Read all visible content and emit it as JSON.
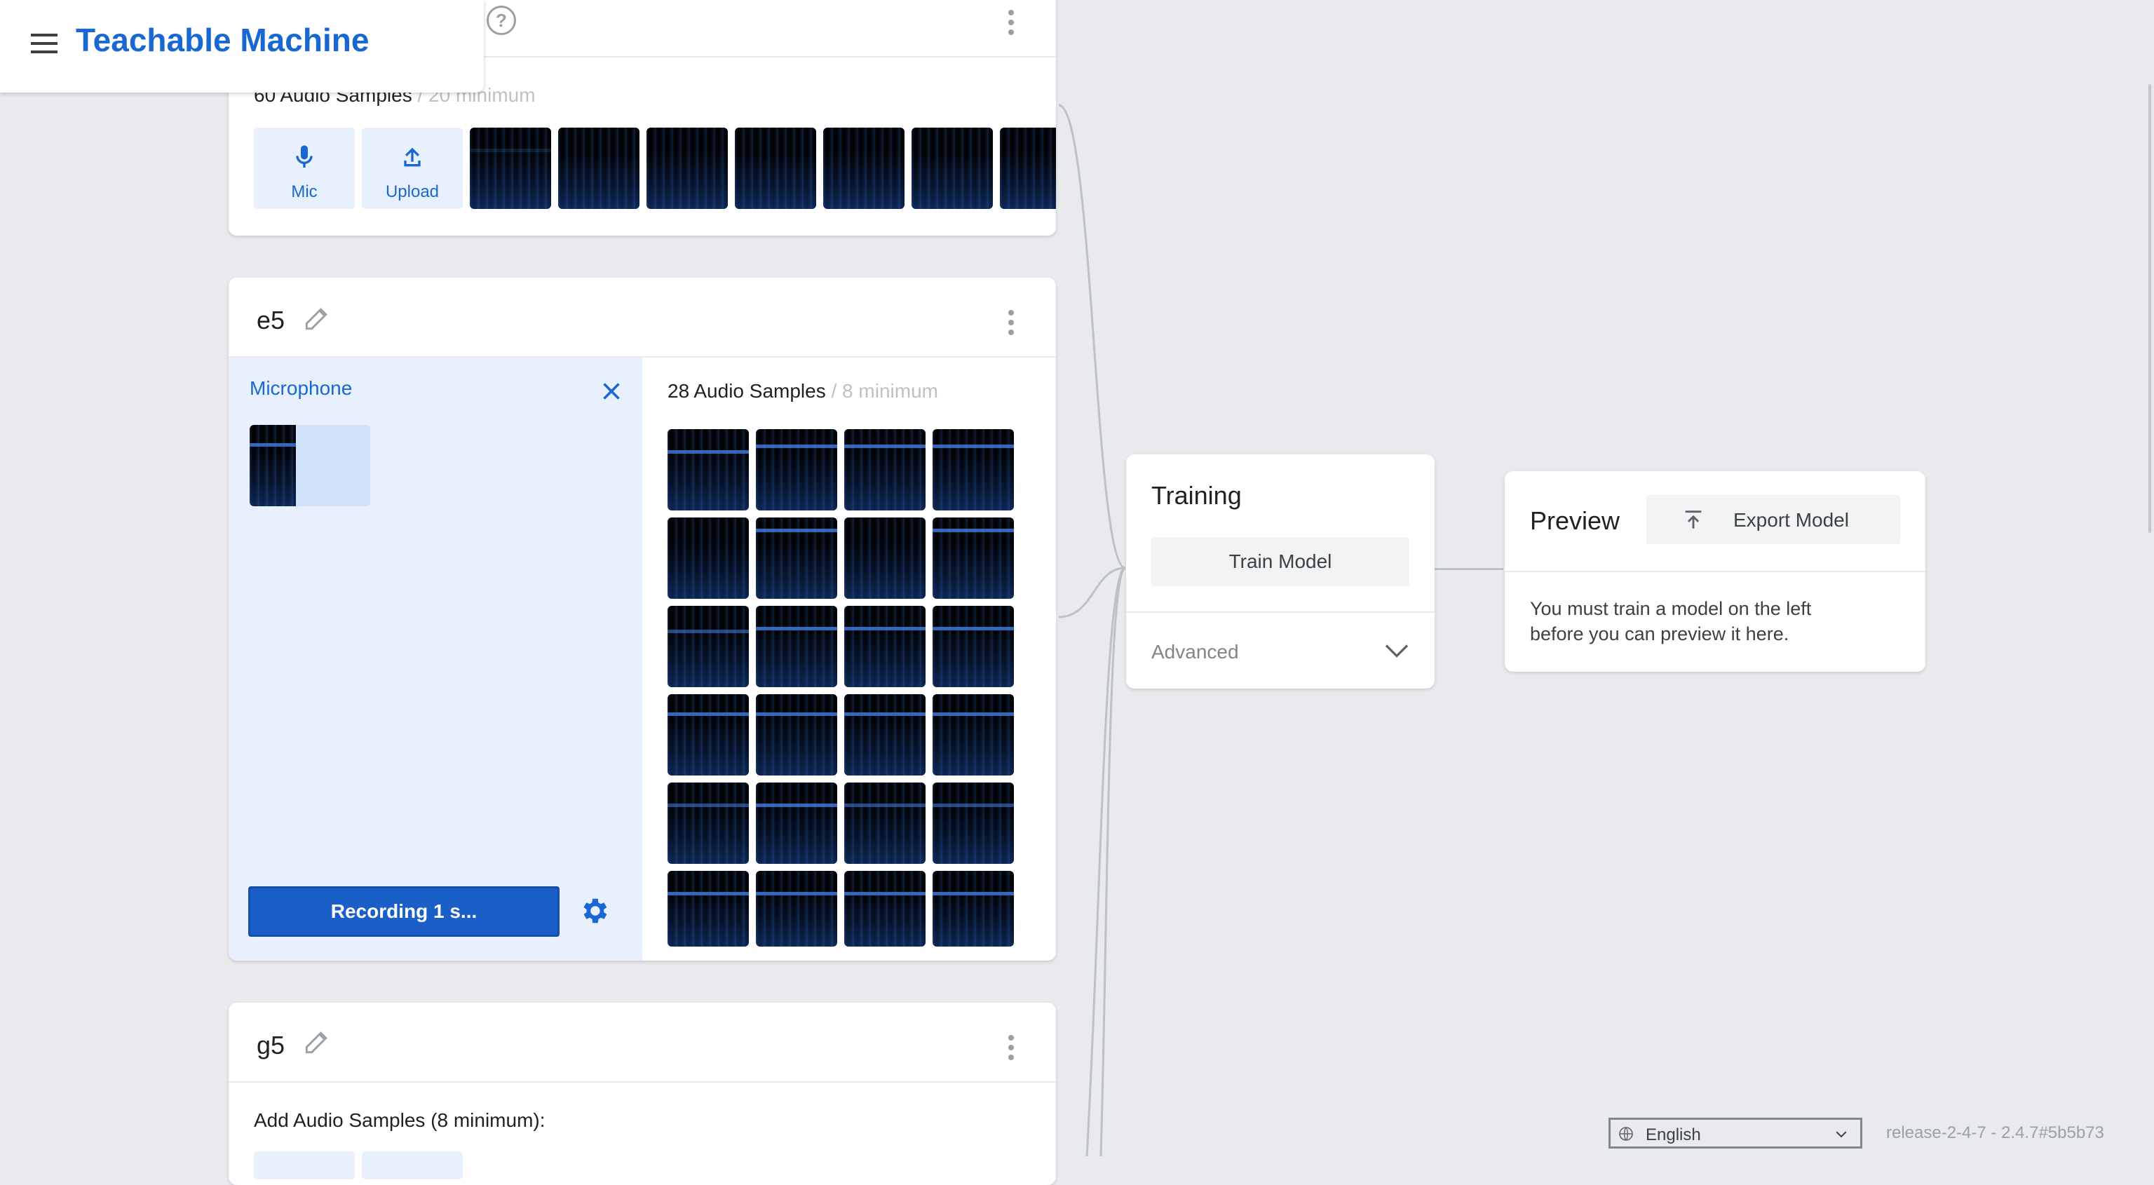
{
  "app": {
    "title": "Teachable Machine"
  },
  "class_top": {
    "samples_label": "60 Audio Samples",
    "minimum_label": "/ 20 minimum",
    "mic_label": "Mic",
    "upload_label": "Upload"
  },
  "class_e5": {
    "name": "e5",
    "microphone_label": "Microphone",
    "samples_label": "28 Audio Samples",
    "minimum_label": "/ 8 minimum",
    "record_button": "Recording 1 s..."
  },
  "class_g5": {
    "name": "g5",
    "add_label": "Add Audio Samples (8 minimum):"
  },
  "training": {
    "title": "Training",
    "train_button": "Train Model",
    "advanced_label": "Advanced"
  },
  "preview": {
    "title": "Preview",
    "export_button": "Export Model",
    "message_line1": "You must train a model on the left",
    "message_line2": "before you can preview it here."
  },
  "footer": {
    "language": "English",
    "version": "release-2-4-7 - 2.4.7#5b5b73"
  },
  "colors": {
    "accent": "#1967d2",
    "record_button": "#1a5fc8",
    "background": "#e8eaed"
  }
}
